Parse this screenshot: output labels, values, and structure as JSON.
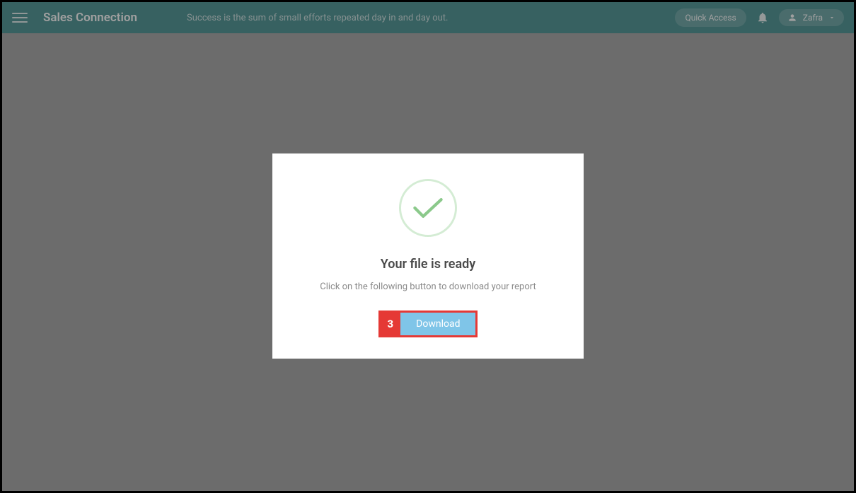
{
  "header": {
    "app_title": "Sales Connection",
    "tagline": "Success is the sum of small efforts repeated day in and day out.",
    "quick_access_label": "Quick Access",
    "user_name": "Zafra"
  },
  "modal": {
    "title": "Your file is ready",
    "subtitle": "Click on the following button to download your report",
    "step_number": "3",
    "download_label": "Download"
  }
}
